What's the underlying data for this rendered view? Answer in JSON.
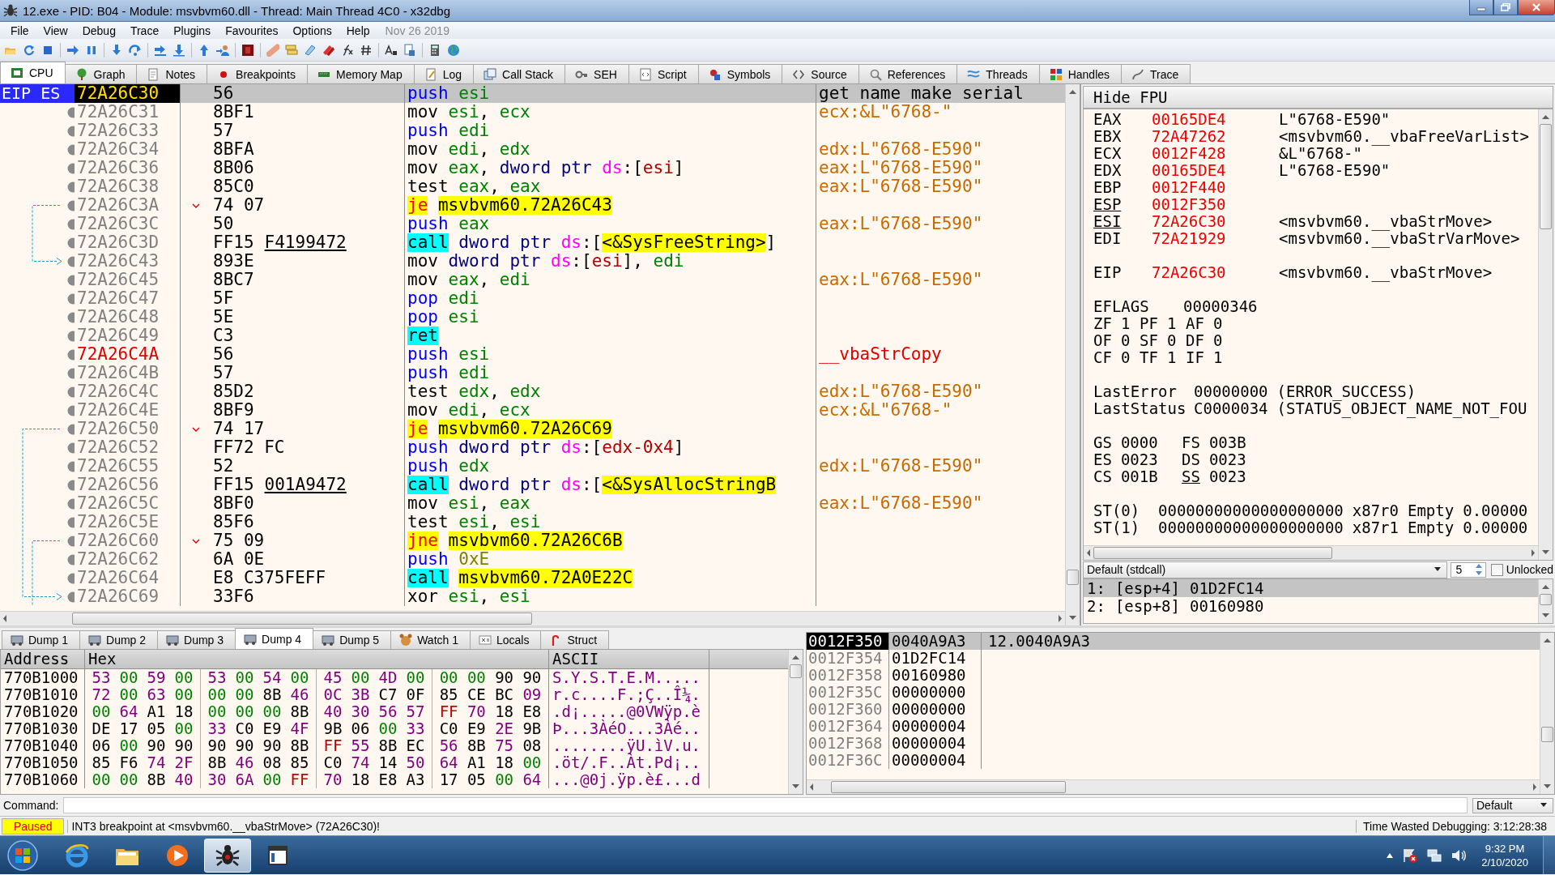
{
  "window": {
    "title": "12.exe - PID: B04 - Module: msvbvm60.dll - Thread: Main Thread 4C0 - x32dbg"
  },
  "menu": {
    "items": [
      "File",
      "View",
      "Debug",
      "Trace",
      "Plugins",
      "Favourites",
      "Options",
      "Help"
    ],
    "build_date": "Nov 26 2019"
  },
  "tabs": [
    {
      "label": "CPU",
      "selected": true
    },
    {
      "label": "Graph",
      "selected": false
    },
    {
      "label": "Notes",
      "selected": false
    },
    {
      "label": "Breakpoints",
      "selected": false
    },
    {
      "label": "Memory Map",
      "selected": false
    },
    {
      "label": "Log",
      "selected": false
    },
    {
      "label": "Call Stack",
      "selected": false
    },
    {
      "label": "SEH",
      "selected": false
    },
    {
      "label": "Script",
      "selected": false
    },
    {
      "label": "Symbols",
      "selected": false
    },
    {
      "label": "Source",
      "selected": false
    },
    {
      "label": "References",
      "selected": false
    },
    {
      "label": "Threads",
      "selected": false
    },
    {
      "label": "Handles",
      "selected": false
    },
    {
      "label": "Trace",
      "selected": false
    }
  ],
  "disassembly": {
    "eip_label": "EIP ES",
    "rows": [
      {
        "address": "72A26C30",
        "bytes": "56",
        "selected": true,
        "label": false,
        "jump": false,
        "mnemonic": {
          "text": "push",
          "kind": "stack"
        },
        "operands": [
          {
            "text": "esi",
            "kind": "reg"
          }
        ],
        "comment": {
          "text": "get name make serial",
          "kind": "note"
        }
      },
      {
        "address": "72A26C31",
        "bytes": "8BF1",
        "selected": false,
        "label": false,
        "jump": false,
        "mnemonic": {
          "text": "mov",
          "kind": "plain"
        },
        "operands": [
          {
            "text": "esi",
            "kind": "reg"
          },
          {
            "text": ", ",
            "kind": "punct"
          },
          {
            "text": "ecx",
            "kind": "reg"
          }
        ],
        "comment": {
          "text": "ecx:&L\"6768-\"",
          "kind": "string"
        }
      },
      {
        "address": "72A26C33",
        "bytes": "57",
        "selected": false,
        "label": false,
        "jump": false,
        "mnemonic": {
          "text": "push",
          "kind": "stack"
        },
        "operands": [
          {
            "text": "edi",
            "kind": "reg"
          }
        ]
      },
      {
        "address": "72A26C34",
        "bytes": "8BFA",
        "selected": false,
        "label": false,
        "jump": false,
        "mnemonic": {
          "text": "mov",
          "kind": "plain"
        },
        "operands": [
          {
            "text": "edi",
            "kind": "reg"
          },
          {
            "text": ", ",
            "kind": "punct"
          },
          {
            "text": "edx",
            "kind": "reg"
          }
        ],
        "comment": {
          "text": "edx:L\"6768-E590\"",
          "kind": "string"
        }
      },
      {
        "address": "72A26C36",
        "bytes": "8B06",
        "selected": false,
        "label": false,
        "jump": false,
        "mnemonic": {
          "text": "mov",
          "kind": "plain"
        },
        "operands": [
          {
            "text": "eax",
            "kind": "reg"
          },
          {
            "text": ", ",
            "kind": "punct"
          },
          {
            "text": "dword ptr ",
            "kind": "size"
          },
          {
            "text": "ds",
            "kind": "seg"
          },
          {
            "text": ":[",
            "kind": "punct"
          },
          {
            "text": "esi",
            "kind": "mem"
          },
          {
            "text": "]",
            "kind": "punct"
          }
        ],
        "comment": {
          "text": "eax:L\"6768-E590\"",
          "kind": "string"
        }
      },
      {
        "address": "72A26C38",
        "bytes": "85C0",
        "selected": false,
        "label": false,
        "jump": false,
        "mnemonic": {
          "text": "test",
          "kind": "plain"
        },
        "operands": [
          {
            "text": "eax",
            "kind": "reg"
          },
          {
            "text": ", ",
            "kind": "punct"
          },
          {
            "text": "eax",
            "kind": "reg"
          }
        ],
        "comment": {
          "text": "eax:L\"6768-E590\"",
          "kind": "string"
        }
      },
      {
        "address": "72A26C3A",
        "bytes": "74 07",
        "selected": false,
        "label": false,
        "jump": true,
        "mnemonic": {
          "text": "je",
          "kind": "jump"
        },
        "operands": [
          {
            "text": "msvbvm60.72A26C43",
            "kind": "target"
          }
        ]
      },
      {
        "address": "72A26C3C",
        "bytes": "50",
        "selected": false,
        "label": false,
        "jump": false,
        "mnemonic": {
          "text": "push",
          "kind": "stack"
        },
        "operands": [
          {
            "text": "eax",
            "kind": "reg"
          }
        ],
        "comment": {
          "text": "eax:L\"6768-E590\"",
          "kind": "string"
        }
      },
      {
        "address": "72A26C3D",
        "bytes": "FF15",
        "ref": "F4199472",
        "selected": false,
        "label": false,
        "jump": false,
        "mnemonic": {
          "text": "call",
          "kind": "call"
        },
        "operands": [
          {
            "text": "dword ptr ",
            "kind": "size"
          },
          {
            "text": "ds",
            "kind": "seg"
          },
          {
            "text": ":[",
            "kind": "punct"
          },
          {
            "text": "<&SysFreeString>",
            "kind": "target"
          },
          {
            "text": "]",
            "kind": "punct"
          }
        ]
      },
      {
        "address": "72A26C43",
        "bytes": "893E",
        "selected": false,
        "label": false,
        "jump": false,
        "mnemonic": {
          "text": "mov",
          "kind": "plain"
        },
        "operands": [
          {
            "text": "dword ptr ",
            "kind": "size"
          },
          {
            "text": "ds",
            "kind": "seg"
          },
          {
            "text": ":[",
            "kind": "punct"
          },
          {
            "text": "esi",
            "kind": "mem"
          },
          {
            "text": "], ",
            "kind": "punct"
          },
          {
            "text": "edi",
            "kind": "reg"
          }
        ]
      },
      {
        "address": "72A26C45",
        "bytes": "8BC7",
        "selected": false,
        "label": false,
        "jump": false,
        "mnemonic": {
          "text": "mov",
          "kind": "plain"
        },
        "operands": [
          {
            "text": "eax",
            "kind": "reg"
          },
          {
            "text": ", ",
            "kind": "punct"
          },
          {
            "text": "edi",
            "kind": "reg"
          }
        ],
        "comment": {
          "text": "eax:L\"6768-E590\"",
          "kind": "string"
        }
      },
      {
        "address": "72A26C47",
        "bytes": "5F",
        "selected": false,
        "label": false,
        "jump": false,
        "mnemonic": {
          "text": "pop",
          "kind": "stack"
        },
        "operands": [
          {
            "text": "edi",
            "kind": "reg"
          }
        ]
      },
      {
        "address": "72A26C48",
        "bytes": "5E",
        "selected": false,
        "label": false,
        "jump": false,
        "mnemonic": {
          "text": "pop",
          "kind": "stack"
        },
        "operands": [
          {
            "text": "esi",
            "kind": "reg"
          }
        ]
      },
      {
        "address": "72A26C49",
        "bytes": "C3",
        "selected": false,
        "label": false,
        "jump": false,
        "mnemonic": {
          "text": "ret",
          "kind": "ret"
        },
        "operands": []
      },
      {
        "address": "72A26C4A",
        "bytes": "56",
        "selected": false,
        "label": true,
        "jump": false,
        "mnemonic": {
          "text": "push",
          "kind": "stack"
        },
        "operands": [
          {
            "text": "esi",
            "kind": "reg"
          }
        ],
        "comment": {
          "text": "__vbaStrCopy",
          "kind": "label"
        }
      },
      {
        "address": "72A26C4B",
        "bytes": "57",
        "selected": false,
        "label": false,
        "jump": false,
        "mnemonic": {
          "text": "push",
          "kind": "stack"
        },
        "operands": [
          {
            "text": "edi",
            "kind": "reg"
          }
        ]
      },
      {
        "address": "72A26C4C",
        "bytes": "85D2",
        "selected": false,
        "label": false,
        "jump": false,
        "mnemonic": {
          "text": "test",
          "kind": "plain"
        },
        "operands": [
          {
            "text": "edx",
            "kind": "reg"
          },
          {
            "text": ", ",
            "kind": "punct"
          },
          {
            "text": "edx",
            "kind": "reg"
          }
        ],
        "comment": {
          "text": "edx:L\"6768-E590\"",
          "kind": "string"
        }
      },
      {
        "address": "72A26C4E",
        "bytes": "8BF9",
        "selected": false,
        "label": false,
        "jump": false,
        "mnemonic": {
          "text": "mov",
          "kind": "plain"
        },
        "operands": [
          {
            "text": "edi",
            "kind": "reg"
          },
          {
            "text": ", ",
            "kind": "punct"
          },
          {
            "text": "ecx",
            "kind": "reg"
          }
        ],
        "comment": {
          "text": "ecx:&L\"6768-\"",
          "kind": "string"
        }
      },
      {
        "address": "72A26C50",
        "bytes": "74 17",
        "selected": false,
        "label": false,
        "jump": true,
        "mnemonic": {
          "text": "je",
          "kind": "jump"
        },
        "operands": [
          {
            "text": "msvbvm60.72A26C69",
            "kind": "target"
          }
        ]
      },
      {
        "address": "72A26C52",
        "bytes": "FF72 FC",
        "selected": false,
        "label": false,
        "jump": false,
        "mnemonic": {
          "text": "push",
          "kind": "stack"
        },
        "operands": [
          {
            "text": "dword ptr ",
            "kind": "size"
          },
          {
            "text": "ds",
            "kind": "seg"
          },
          {
            "text": ":[",
            "kind": "punct"
          },
          {
            "text": "edx-0x4",
            "kind": "mem"
          },
          {
            "text": "]",
            "kind": "punct"
          }
        ]
      },
      {
        "address": "72A26C55",
        "bytes": "52",
        "selected": false,
        "label": false,
        "jump": false,
        "mnemonic": {
          "text": "push",
          "kind": "stack"
        },
        "operands": [
          {
            "text": "edx",
            "kind": "reg"
          }
        ],
        "comment": {
          "text": "edx:L\"6768-E590\"",
          "kind": "string"
        }
      },
      {
        "address": "72A26C56",
        "bytes": "FF15",
        "ref": "001A9472",
        "selected": false,
        "label": false,
        "jump": false,
        "mnemonic": {
          "text": "call",
          "kind": "call"
        },
        "operands": [
          {
            "text": "dword ptr ",
            "kind": "size"
          },
          {
            "text": "ds",
            "kind": "seg"
          },
          {
            "text": ":[",
            "kind": "punct"
          },
          {
            "text": "<&SysAllocStringB",
            "kind": "target"
          }
        ]
      },
      {
        "address": "72A26C5C",
        "bytes": "8BF0",
        "selected": false,
        "label": false,
        "jump": false,
        "mnemonic": {
          "text": "mov",
          "kind": "plain"
        },
        "operands": [
          {
            "text": "esi",
            "kind": "reg"
          },
          {
            "text": ", ",
            "kind": "punct"
          },
          {
            "text": "eax",
            "kind": "reg"
          }
        ],
        "comment": {
          "text": "eax:L\"6768-E590\"",
          "kind": "string"
        }
      },
      {
        "address": "72A26C5E",
        "bytes": "85F6",
        "selected": false,
        "label": false,
        "jump": false,
        "mnemonic": {
          "text": "test",
          "kind": "plain"
        },
        "operands": [
          {
            "text": "esi",
            "kind": "reg"
          },
          {
            "text": ", ",
            "kind": "punct"
          },
          {
            "text": "esi",
            "kind": "reg"
          }
        ]
      },
      {
        "address": "72A26C60",
        "bytes": "75 09",
        "selected": false,
        "label": false,
        "jump": true,
        "mnemonic": {
          "text": "jne",
          "kind": "jump"
        },
        "operands": [
          {
            "text": "msvbvm60.72A26C6B",
            "kind": "target"
          }
        ]
      },
      {
        "address": "72A26C62",
        "bytes": "6A 0E",
        "selected": false,
        "label": false,
        "jump": false,
        "mnemonic": {
          "text": "push",
          "kind": "stack"
        },
        "operands": [
          {
            "text": "0xE",
            "kind": "imm"
          }
        ]
      },
      {
        "address": "72A26C64",
        "bytes": "E8 C375FEFF",
        "selected": false,
        "label": false,
        "jump": false,
        "mnemonic": {
          "text": "call",
          "kind": "call"
        },
        "operands": [
          {
            "text": "msvbvm60.72A0E22C",
            "kind": "target"
          }
        ]
      },
      {
        "address": "72A26C69",
        "bytes": "33F6",
        "selected": false,
        "label": false,
        "jump": false,
        "mnemonic": {
          "text": "xor",
          "kind": "plain"
        },
        "operands": [
          {
            "text": "esi",
            "kind": "reg"
          },
          {
            "text": ", ",
            "kind": "punct"
          },
          {
            "text": "esi",
            "kind": "reg"
          }
        ]
      }
    ]
  },
  "register_panel": {
    "toggle": "Hide FPU",
    "groups": [
      [
        {
          "name": "EAX",
          "value": "00165DE4",
          "changed": true,
          "underlined": false,
          "comment": "L\"6768-E590\""
        },
        {
          "name": "EBX",
          "value": "72A47262",
          "changed": true,
          "underlined": false,
          "comment": "<msvbvm60.__vbaFreeVarList>"
        },
        {
          "name": "ECX",
          "value": "0012F428",
          "changed": true,
          "underlined": false,
          "comment": "&L\"6768-\""
        },
        {
          "name": "EDX",
          "value": "00165DE4",
          "changed": true,
          "underlined": false,
          "comment": "L\"6768-E590\""
        },
        {
          "name": "EBP",
          "value": "0012F440",
          "changed": true,
          "underlined": false
        },
        {
          "name": "ESP",
          "value": "0012F350",
          "changed": true,
          "underlined": true
        },
        {
          "name": "ESI",
          "value": "72A26C30",
          "changed": true,
          "underlined": true,
          "comment": "<msvbvm60.__vbaStrMove>"
        },
        {
          "name": "EDI",
          "value": "72A21929",
          "changed": true,
          "underlined": false,
          "comment": "<msvbvm60.__vbaStrVarMove>"
        }
      ],
      [
        {
          "name": "EIP",
          "value": "72A26C30",
          "changed": true,
          "underlined": false,
          "comment": "<msvbvm60.__vbaStrMove>"
        }
      ]
    ],
    "eflags": {
      "name": "EFLAGS",
      "value": "00000346"
    },
    "flags": [
      [
        {
          "name": "ZF",
          "value": "1"
        },
        {
          "name": "PF",
          "value": "1"
        },
        {
          "name": "AF",
          "value": "0"
        }
      ],
      [
        {
          "name": "OF",
          "value": "0"
        },
        {
          "name": "SF",
          "value": "0"
        },
        {
          "name": "DF",
          "value": "0"
        }
      ],
      [
        {
          "name": "CF",
          "value": "0"
        },
        {
          "name": "TF",
          "value": "1"
        },
        {
          "name": "IF",
          "value": "1"
        }
      ]
    ],
    "errors": [
      {
        "name": "LastError",
        "value": "00000000",
        "text": "(ERROR_SUCCESS)"
      },
      {
        "name": "LastStatus",
        "value": "C0000034",
        "text": "(STATUS_OBJECT_NAME_NOT_FOU"
      }
    ],
    "segments": [
      [
        {
          "name": "GS",
          "value": "0000",
          "underlined": false
        },
        {
          "name": "FS",
          "value": "003B",
          "underlined": false
        }
      ],
      [
        {
          "name": "ES",
          "value": "0023",
          "underlined": false
        },
        {
          "name": "DS",
          "value": "0023",
          "underlined": false
        }
      ],
      [
        {
          "name": "CS",
          "value": "001B",
          "underlined": false
        },
        {
          "name": "SS",
          "value": "0023",
          "underlined": true
        }
      ]
    ],
    "fpu": [
      {
        "name": "ST(0)",
        "value": "00000000000000000000",
        "register": "x87r0",
        "tag": "Empty",
        "number": "0.00000"
      },
      {
        "name": "ST(1)",
        "value": "00000000000000000000",
        "register": "x87r1",
        "tag": "Empty",
        "number": "0.00000"
      }
    ]
  },
  "call_args": {
    "convention": "Default (stdcall)",
    "count": "5",
    "lock_label": "Unlocked",
    "checked": false,
    "rows": [
      {
        "index": "1:",
        "expr": "[esp+4]",
        "value": "01D2FC14",
        "selected": true
      },
      {
        "index": "2:",
        "expr": "[esp+8]",
        "value": "00160980",
        "selected": false
      }
    ]
  },
  "dump_tabs": [
    {
      "label": "Dump 1",
      "selected": false
    },
    {
      "label": "Dump 2",
      "selected": false
    },
    {
      "label": "Dump 3",
      "selected": false
    },
    {
      "label": "Dump 4",
      "selected": true
    },
    {
      "label": "Dump 5",
      "selected": false
    },
    {
      "label": "Watch 1",
      "selected": false
    },
    {
      "label": "Locals",
      "selected": false
    },
    {
      "label": "Struct",
      "selected": false
    }
  ],
  "dump": {
    "columns": [
      "Address",
      "Hex",
      "ASCII"
    ],
    "rows": [
      {
        "address": "770B1000",
        "ascii": "S.Y.S.T.E.M.....",
        "bytes": [
          {
            "text": "53",
            "kind": "print"
          },
          {
            "text": "00",
            "kind": "zero"
          },
          {
            "text": "59",
            "kind": "print"
          },
          {
            "text": "00",
            "kind": "zero"
          },
          {
            "text": "53",
            "kind": "print"
          },
          {
            "text": "00",
            "kind": "zero"
          },
          {
            "text": "54",
            "kind": "print"
          },
          {
            "text": "00",
            "kind": "zero"
          },
          {
            "text": "45",
            "kind": "print"
          },
          {
            "text": "00",
            "kind": "zero"
          },
          {
            "text": "4D",
            "kind": "print"
          },
          {
            "text": "00",
            "kind": "zero"
          },
          {
            "text": "00",
            "kind": "zero"
          },
          {
            "text": "00",
            "kind": "zero"
          },
          {
            "text": "90",
            "kind": "other"
          },
          {
            "text": "90",
            "kind": "other"
          }
        ]
      },
      {
        "address": "770B1010",
        "ascii": "r.c....F.;Ç..Î¼.",
        "bytes": [
          {
            "text": "72",
            "kind": "print"
          },
          {
            "text": "00",
            "kind": "zero"
          },
          {
            "text": "63",
            "kind": "print"
          },
          {
            "text": "00",
            "kind": "zero"
          },
          {
            "text": "00",
            "kind": "zero"
          },
          {
            "text": "00",
            "kind": "zero"
          },
          {
            "text": "8B",
            "kind": "other"
          },
          {
            "text": "46",
            "kind": "print"
          },
          {
            "text": "0C",
            "kind": "print"
          },
          {
            "text": "3B",
            "kind": "print"
          },
          {
            "text": "C7",
            "kind": "other"
          },
          {
            "text": "0F",
            "kind": "other"
          },
          {
            "text": "85",
            "kind": "other"
          },
          {
            "text": "CE",
            "kind": "other"
          },
          {
            "text": "BC",
            "kind": "other"
          },
          {
            "text": "09",
            "kind": "print"
          }
        ]
      },
      {
        "address": "770B1020",
        "ascii": ".d¡.....@0VWÿp.è",
        "bytes": [
          {
            "text": "00",
            "kind": "zero"
          },
          {
            "text": "64",
            "kind": "print"
          },
          {
            "text": "A1",
            "kind": "other"
          },
          {
            "text": "18",
            "kind": "other"
          },
          {
            "text": "00",
            "kind": "zero"
          },
          {
            "text": "00",
            "kind": "zero"
          },
          {
            "text": "00",
            "kind": "zero"
          },
          {
            "text": "8B",
            "kind": "other"
          },
          {
            "text": "40",
            "kind": "print"
          },
          {
            "text": "30",
            "kind": "print"
          },
          {
            "text": "56",
            "kind": "print"
          },
          {
            "text": "57",
            "kind": "print"
          },
          {
            "text": "FF",
            "kind": "ff"
          },
          {
            "text": "70",
            "kind": "print"
          },
          {
            "text": "18",
            "kind": "other"
          },
          {
            "text": "E8",
            "kind": "other"
          }
        ]
      },
      {
        "address": "770B1030",
        "ascii": "Þ...3ÀéO...3Àé..",
        "bytes": [
          {
            "text": "DE",
            "kind": "other"
          },
          {
            "text": "17",
            "kind": "other"
          },
          {
            "text": "05",
            "kind": "other"
          },
          {
            "text": "00",
            "kind": "zero"
          },
          {
            "text": "33",
            "kind": "print"
          },
          {
            "text": "C0",
            "kind": "other"
          },
          {
            "text": "E9",
            "kind": "other"
          },
          {
            "text": "4F",
            "kind": "print"
          },
          {
            "text": "9B",
            "kind": "other"
          },
          {
            "text": "06",
            "kind": "other"
          },
          {
            "text": "00",
            "kind": "zero"
          },
          {
            "text": "33",
            "kind": "print"
          },
          {
            "text": "C0",
            "kind": "other"
          },
          {
            "text": "E9",
            "kind": "other"
          },
          {
            "text": "2E",
            "kind": "print"
          },
          {
            "text": "9B",
            "kind": "other"
          }
        ]
      },
      {
        "address": "770B1040",
        "ascii": "........ÿU.ìV.u.",
        "bytes": [
          {
            "text": "06",
            "kind": "other"
          },
          {
            "text": "00",
            "kind": "zero"
          },
          {
            "text": "90",
            "kind": "other"
          },
          {
            "text": "90",
            "kind": "other"
          },
          {
            "text": "90",
            "kind": "other"
          },
          {
            "text": "90",
            "kind": "other"
          },
          {
            "text": "90",
            "kind": "other"
          },
          {
            "text": "8B",
            "kind": "other"
          },
          {
            "text": "FF",
            "kind": "ff"
          },
          {
            "text": "55",
            "kind": "print"
          },
          {
            "text": "8B",
            "kind": "other"
          },
          {
            "text": "EC",
            "kind": "other"
          },
          {
            "text": "56",
            "kind": "print"
          },
          {
            "text": "8B",
            "kind": "other"
          },
          {
            "text": "75",
            "kind": "print"
          },
          {
            "text": "08",
            "kind": "other"
          }
        ]
      },
      {
        "address": "770B1050",
        "ascii": ".öt/.F..Àt.Pd¡..",
        "bytes": [
          {
            "text": "85",
            "kind": "other"
          },
          {
            "text": "F6",
            "kind": "other"
          },
          {
            "text": "74",
            "kind": "print"
          },
          {
            "text": "2F",
            "kind": "print"
          },
          {
            "text": "8B",
            "kind": "other"
          },
          {
            "text": "46",
            "kind": "print"
          },
          {
            "text": "08",
            "kind": "other"
          },
          {
            "text": "85",
            "kind": "other"
          },
          {
            "text": "C0",
            "kind": "other"
          },
          {
            "text": "74",
            "kind": "print"
          },
          {
            "text": "14",
            "kind": "other"
          },
          {
            "text": "50",
            "kind": "print"
          },
          {
            "text": "64",
            "kind": "print"
          },
          {
            "text": "A1",
            "kind": "other"
          },
          {
            "text": "18",
            "kind": "other"
          },
          {
            "text": "00",
            "kind": "zero"
          }
        ]
      },
      {
        "address": "770B1060",
        "ascii": "...@0j.ÿp.è£...d",
        "bytes": [
          {
            "text": "00",
            "kind": "zero"
          },
          {
            "text": "00",
            "kind": "zero"
          },
          {
            "text": "8B",
            "kind": "other"
          },
          {
            "text": "40",
            "kind": "print"
          },
          {
            "text": "30",
            "kind": "print"
          },
          {
            "text": "6A",
            "kind": "print"
          },
          {
            "text": "00",
            "kind": "zero"
          },
          {
            "text": "FF",
            "kind": "ff"
          },
          {
            "text": "70",
            "kind": "print"
          },
          {
            "text": "18",
            "kind": "other"
          },
          {
            "text": "E8",
            "kind": "other"
          },
          {
            "text": "A3",
            "kind": "other"
          },
          {
            "text": "17",
            "kind": "other"
          },
          {
            "text": "05",
            "kind": "other"
          },
          {
            "text": "00",
            "kind": "zero"
          },
          {
            "text": "64",
            "kind": "print"
          }
        ]
      }
    ]
  },
  "stack": {
    "rows": [
      {
        "address": "0012F350",
        "value": "0040A9A3",
        "comment": "12.0040A9A3",
        "selected": true
      },
      {
        "address": "0012F354",
        "value": "01D2FC14",
        "selected": false
      },
      {
        "address": "0012F358",
        "value": "00160980",
        "selected": false
      },
      {
        "address": "0012F35C",
        "value": "00000000",
        "selected": false
      },
      {
        "address": "0012F360",
        "value": "00000000",
        "selected": false
      },
      {
        "address": "0012F364",
        "value": "00000004",
        "selected": false
      },
      {
        "address": "0012F368",
        "value": "00000004",
        "selected": false
      },
      {
        "address": "0012F36C",
        "value": "00000004",
        "selected": false
      }
    ]
  },
  "command": {
    "label": "Command:",
    "mode": "Default"
  },
  "status_bar": {
    "state": "Paused",
    "message": "INT3 breakpoint at <msvbvm60.__vbaStrMove> (72A26C30)!",
    "timer": "Time Wasted Debugging: 3:12:28:38"
  },
  "taskbar": {
    "apps": [
      {
        "selected": false
      },
      {
        "selected": false
      },
      {
        "selected": false
      },
      {
        "selected": true
      },
      {
        "selected": false
      }
    ],
    "time": "9:32 PM",
    "date": "2/10/2020"
  }
}
